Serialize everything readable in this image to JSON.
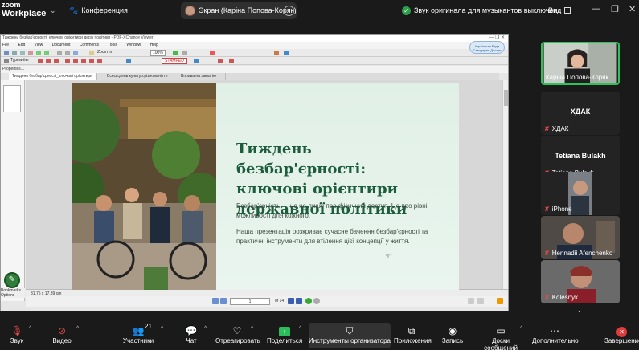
{
  "top": {
    "logo_line1": "zoom",
    "logo_line2": "Workplace",
    "conference": "Конференция",
    "screen_label": "Экран (Каріна Попова-Коряк)",
    "status": "Звук оригинала для музыкантов выключен",
    "view": "Вид"
  },
  "pdf": {
    "title": "Тиждень безбар'єрності_ключові орієнтири держ політики - PDF-XChange Viewer",
    "menu": [
      "File",
      "Edit",
      "View",
      "Document",
      "Comments",
      "Tools",
      "Window",
      "Help"
    ],
    "zoom": "100%",
    "zoom_in": "Zoom In",
    "typewriter": "Typewriter",
    "stamp": "STAMPED",
    "properties": "Properties...",
    "tabs": [
      "Тиждень безбар'єрності_ключові орієнтири дер...",
      "Всесв.день культур.різноманіття",
      "Вправа на эмпатію"
    ],
    "left_bottom1": "Bookmarks",
    "left_bottom2": "Options",
    "size": "31,75 x 17,89 cm",
    "page_current": "1",
    "page_total": "of 14",
    "badge_text": "Українська Рада Стандартів Доступ"
  },
  "slide": {
    "title": "Тиждень безбар'єрності: ключові орієнтири державної політики",
    "p1": "Безбар'єрність — це не лише про фізичний доступ. Це про рівні можливості для кожного.",
    "p2": "Наша презентація розкриває сучасне бачення безбар'єрності та практичні інструменти для втілення цієї концепції у життя."
  },
  "participants": [
    {
      "name": "Каріна Попова-Коряк",
      "type": "video",
      "active": true
    },
    {
      "big": "ХДАК",
      "name": "ХДАК",
      "type": "name"
    },
    {
      "big": "Tetiana Bulakh",
      "name": "Tetiana Bulakh",
      "type": "name"
    },
    {
      "name": "iPhone",
      "type": "video"
    },
    {
      "name": "Hennadii Afenchenko",
      "type": "video"
    },
    {
      "name": "Kolesnyk",
      "type": "video"
    }
  ],
  "toolbar": {
    "audio": "Звук",
    "video": "Видео",
    "participants": "Участники",
    "participants_count": "21",
    "chat": "Чат",
    "react": "Отреагировать",
    "share": "Поделиться",
    "host_tools": "Инструменты организатора",
    "apps": "Приложения",
    "record": "Запись",
    "boards": "Доски сообщений",
    "more": "Дополнительно",
    "end": "Завершение"
  }
}
